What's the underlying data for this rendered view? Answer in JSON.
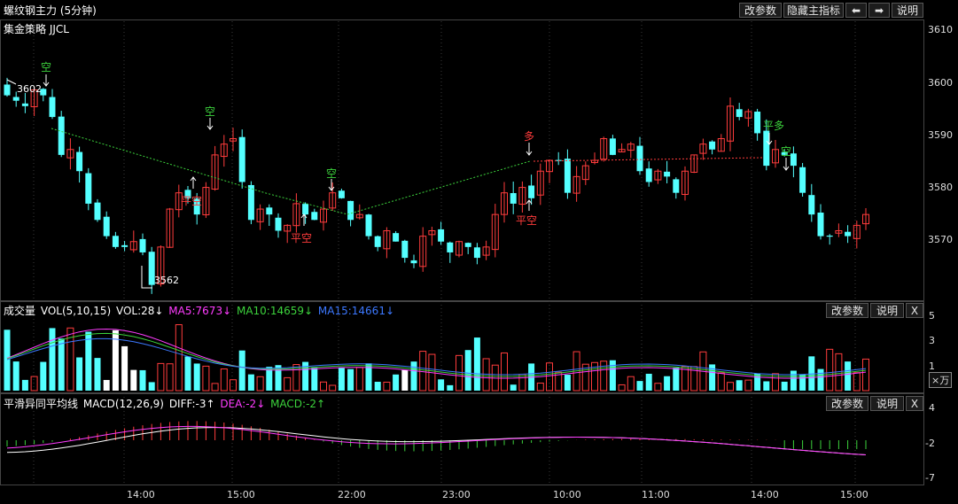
{
  "title_bar": {
    "title": "螺纹钢主力 (5分钟)",
    "buttons": {
      "params": "改参数",
      "hide_main": "隐藏主指标",
      "left": "⬅",
      "right": "➡",
      "help": "说明"
    }
  },
  "main_panel": {
    "strategy": "集金策略 JJCL",
    "y_ticks": [
      3610,
      3600,
      3590,
      3580,
      3570
    ],
    "annotations": {
      "high_label": "3602",
      "low_label": "3562"
    },
    "signals": {
      "kong": "空",
      "ping_kong": "平空",
      "duo": "多",
      "ping_duo": "平多"
    }
  },
  "volume_panel": {
    "name": "成交量",
    "indicator": "VOL(5,10,15)",
    "vol": "VOL:28↓",
    "ma5": "MA5:7673↓",
    "ma10": "MA10:14659↓",
    "ma15": "MA15:14661↓",
    "y_ticks": [
      "5",
      "3",
      "1"
    ],
    "unit": "×万",
    "buttons": {
      "params": "改参数",
      "help": "说明",
      "close": "X"
    }
  },
  "macd_panel": {
    "name": "平滑异同平均线",
    "indicator": "MACD(12,26,9)",
    "diff": "DIFF:-3↑",
    "dea": "DEA:-2↓",
    "macd": "MACD:-2↑",
    "y_ticks": [
      "4",
      "-2",
      "-7"
    ],
    "buttons": {
      "params": "改参数",
      "help": "说明",
      "close": "X"
    }
  },
  "time_axis": [
    "14:00",
    "15:00",
    "22:00",
    "23:00",
    "10:00",
    "11:00",
    "14:00",
    "15:00"
  ],
  "colors": {
    "up": "#ff3c3c",
    "down": "#54ffff",
    "kong": "#3cd23c",
    "duo": "#ff3c3c",
    "ma5": "#ff3cff",
    "ma10": "#3cd23c",
    "ma15": "#3c78ff",
    "trend_line": "#3cd23c",
    "dea": "#ff3cff",
    "diff": "#ffffff"
  },
  "chart_data": {
    "type": "candlestick",
    "title": "螺纹钢主力 (5分钟)",
    "ylim": [
      3560,
      3612
    ],
    "x_tick_labels": [
      "14:00",
      "15:00",
      "22:00",
      "23:00",
      "10:00",
      "11:00",
      "14:00",
      "15:00"
    ],
    "closes": [
      3598,
      3597,
      3596,
      3599,
      3598,
      3594,
      3587,
      3588,
      3584,
      3578,
      3575,
      3572,
      3570,
      3570,
      3571,
      3569,
      3563,
      3570,
      3577,
      3580,
      3579,
      3576,
      3581,
      3587,
      3589,
      3590,
      3582,
      3575,
      3577,
      3576,
      3573,
      3574,
      3578,
      3576,
      3575,
      3577,
      3580,
      3579,
      3575,
      3576,
      3572,
      3570,
      3573,
      3571,
      3568,
      3567,
      3572,
      3573,
      3571,
      3569,
      3571,
      3570,
      3568,
      3570,
      3576,
      3580,
      3578,
      3581,
      3579,
      3584,
      3586,
      3586,
      3580,
      3583,
      3585,
      3586,
      3590,
      3587,
      3588,
      3589,
      3584,
      3582,
      3584,
      3583,
      3580,
      3584,
      3587,
      3589,
      3588,
      3590,
      3596,
      3594,
      3595,
      3591,
      3585,
      3588,
      3587,
      3585,
      3580,
      3576,
      3572,
      3572,
      3573,
      3572,
      3574,
      3576
    ],
    "volume_y_ticks": [
      5,
      3,
      1
    ],
    "macd_y_ticks": [
      4,
      -2,
      -7
    ]
  }
}
